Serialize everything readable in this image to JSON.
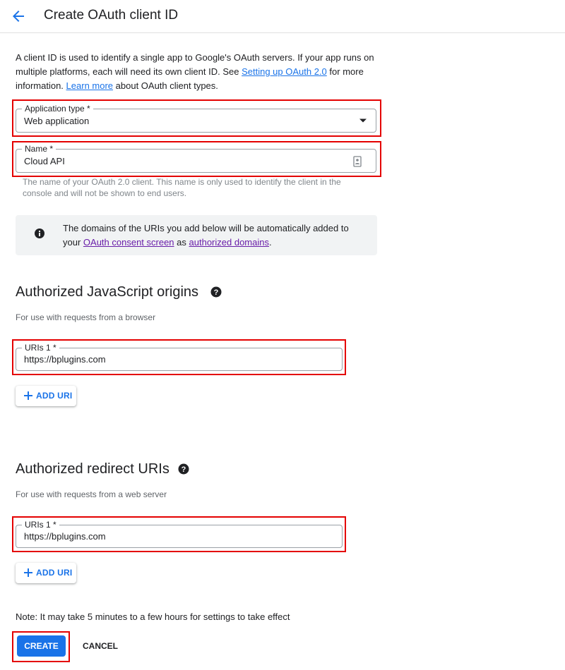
{
  "header": {
    "title": "Create OAuth client ID",
    "back_icon": "arrow-back-icon"
  },
  "intro": {
    "text_before_link1": "A client ID is used to identify a single app to Google's OAuth servers. If your app runs on multiple platforms, each will need its own client ID. See ",
    "link1": "Setting up OAuth 2.0",
    "text_after_link1": " for more information. ",
    "link2": "Learn more",
    "text_end": " about OAuth client types."
  },
  "app_type": {
    "label": "Application type *",
    "value": "Web application",
    "icon": "dropdown-arrow-icon"
  },
  "name_field": {
    "label": "Name *",
    "value": "Cloud API",
    "icon": "contact-card-icon",
    "hint": "The name of your OAuth 2.0 client. This name is only used to identify the client in the console and will not be shown to end users."
  },
  "info": {
    "text1": "The domains of the URIs you add below will be automatically added to your ",
    "link1": "OAuth consent screen",
    "text2": " as ",
    "link2": "authorized domains",
    "text3": ".",
    "icon": "info-icon"
  },
  "js_origins": {
    "title": "Authorized JavaScript origins",
    "subtitle": "For use with requests from a browser",
    "uri_label": "URIs 1 *",
    "uri_value": "https://bplugins.com",
    "add_label": "ADD URI"
  },
  "redirect": {
    "title": "Authorized redirect URIs",
    "subtitle": "For use with requests from a web server",
    "uri_label": "URIs 1 *",
    "uri_value": "https://bplugins.com",
    "add_label": "ADD URI"
  },
  "note": "Note: It may take 5 minutes to a few hours for settings to take effect",
  "actions": {
    "create": "CREATE",
    "cancel": "CANCEL"
  },
  "colors": {
    "accent": "#1a73e8",
    "highlight": "#e40000",
    "visited_link": "#681da8"
  }
}
